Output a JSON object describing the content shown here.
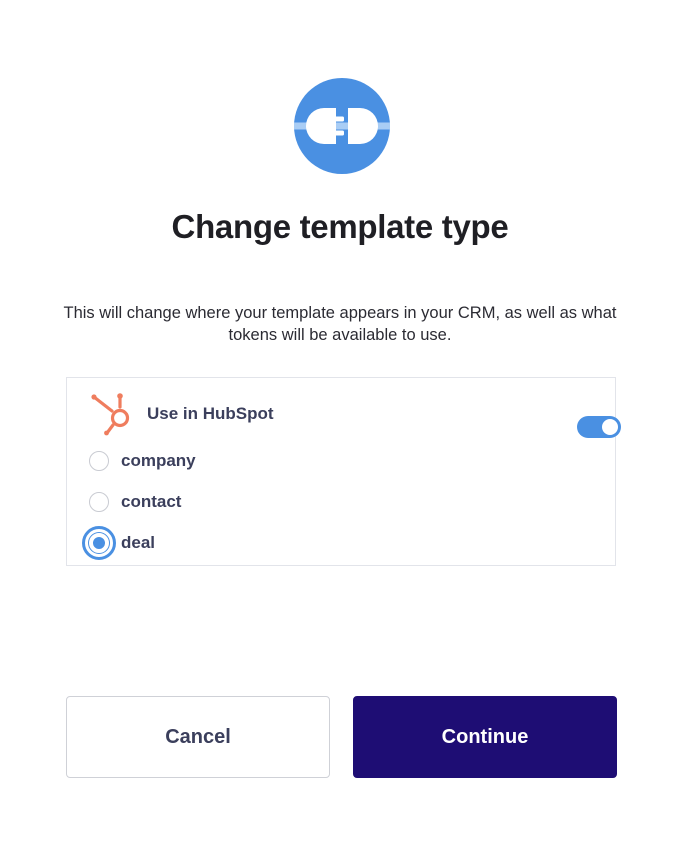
{
  "dialog": {
    "title": "Change template type",
    "description": "This will change where your template appears in your CRM, as well as what tokens will be available to use."
  },
  "integration": {
    "label": "Use in HubSpot",
    "icon": "hubspot-logo-icon",
    "enabled": true,
    "options": [
      {
        "label": "company",
        "selected": false
      },
      {
        "label": "contact",
        "selected": false
      },
      {
        "label": "deal",
        "selected": true
      }
    ]
  },
  "buttons": {
    "cancel_label": "Cancel",
    "continue_label": "Continue"
  },
  "colors": {
    "accent": "#4a90e2",
    "primary_button": "#1e0d74",
    "hubspot_orange": "#ef7d5e"
  }
}
